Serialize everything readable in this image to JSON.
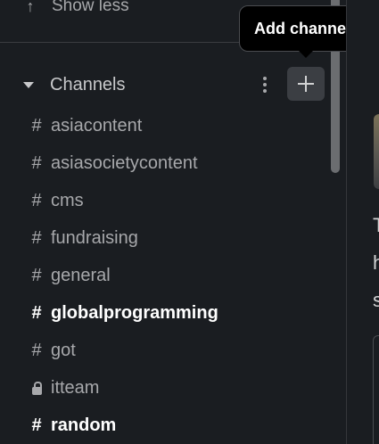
{
  "sidebar": {
    "show_less_label": "Show less",
    "show_less_arrow": "↑",
    "channels_section": {
      "title": "Channels",
      "add_tooltip": "Add channels"
    },
    "channels": [
      {
        "prefix": "#",
        "name": "asiacontent",
        "unread": false,
        "private": false
      },
      {
        "prefix": "#",
        "name": "asiasocietycontent",
        "unread": false,
        "private": false
      },
      {
        "prefix": "#",
        "name": "cms",
        "unread": false,
        "private": false
      },
      {
        "prefix": "#",
        "name": "fundraising",
        "unread": false,
        "private": false
      },
      {
        "prefix": "#",
        "name": "general",
        "unread": false,
        "private": false
      },
      {
        "prefix": "#",
        "name": "globalprogramming",
        "unread": true,
        "private": false
      },
      {
        "prefix": "#",
        "name": "got",
        "unread": false,
        "private": false
      },
      {
        "prefix": "lock",
        "name": "itteam",
        "unread": false,
        "private": true
      },
      {
        "prefix": "#",
        "name": "random",
        "unread": true,
        "private": false
      }
    ]
  },
  "main": {
    "snippet_chars": [
      "T",
      "h",
      "s"
    ]
  },
  "colors": {
    "sidebar_bg": "#1a1d21",
    "muted_text": "#a7a8ab",
    "bright_text": "#ffffff",
    "add_button_bg": "#3b3e43",
    "tooltip_bg": "#000000"
  }
}
